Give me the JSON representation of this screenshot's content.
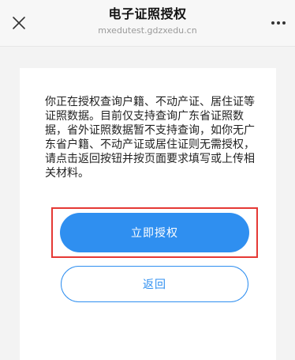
{
  "header": {
    "title": "电子证照授权",
    "subtitle": "mxedutest.gdzxedu.cn",
    "close_icon": "close-icon",
    "more_icon": "more-icon"
  },
  "card": {
    "message": "你正在授权查询户籍、不动产证、居住证等证照数据。目前仅支持查询广东省证照数据，省外证照数据暂不支持查询，如你无广东省户籍、不动产证或居住证则无需授权，请点击返回按钮并按页面要求填写或上传相关材料。",
    "authorize_label": "立即授权",
    "back_label": "返回"
  },
  "colors": {
    "primary": "#2f8ff0",
    "highlight": "#e53935",
    "background": "#f3f3f3",
    "card": "#ffffff"
  }
}
